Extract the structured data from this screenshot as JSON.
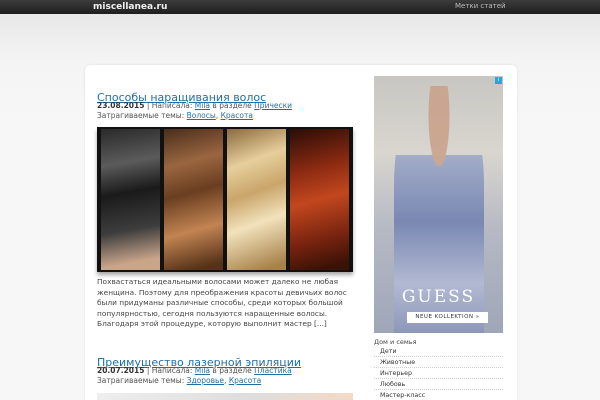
{
  "header": {
    "site_title": "miscellanea.ru",
    "tags_link": "Метки статей"
  },
  "posts": [
    {
      "title": "Способы наращивания волос",
      "date": "23.08.2015",
      "author_prefix": "| Написала:",
      "author": "Mila",
      "section_prefix": "в разделе",
      "section": "Прически",
      "tags_label": "Затрагиваемые темы:",
      "tags": [
        "Волосы",
        "Красота"
      ],
      "excerpt": "Похвастаться идеальными волосами может далеко не любая женщина. Поэтому для преображения красоты девичьих волос были придуманы различные способы, среди которых большой популярностью, сегодня пользуются наращенные волосы. Благодаря этой процедуре, которую выполнит мастер [...]"
    },
    {
      "title": "Преимущество лазерной эпиляции",
      "date": "20.07.2015",
      "author_prefix": "| Написала:",
      "author": "Mila",
      "section_prefix": "в разделе",
      "section": "Пластика",
      "tags_label": "Затрагиваемые темы:",
      "tags": [
        "Здоровье",
        "Красота"
      ]
    }
  ],
  "ad": {
    "brand": "GUESS",
    "cta": "NEUE KOLLEKTION »"
  },
  "sidebar": {
    "heading": "Дом и семья",
    "categories": [
      "Дети",
      "Животные",
      "Интерьер",
      "Любовь",
      "Мастер-класс"
    ]
  }
}
